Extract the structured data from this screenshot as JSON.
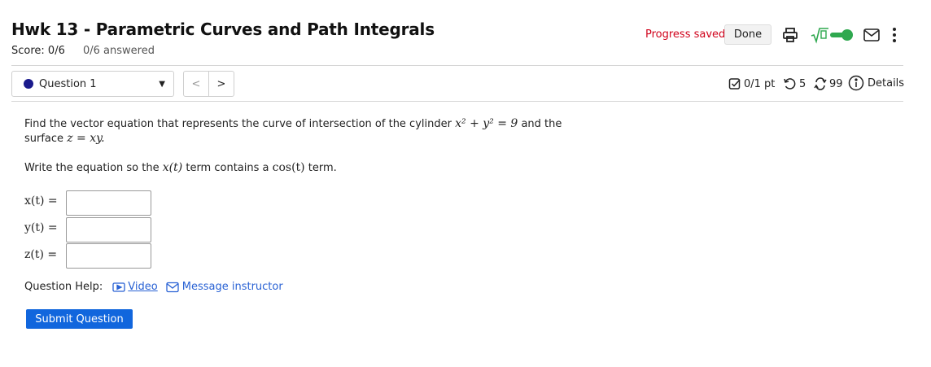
{
  "header": {
    "title": "Hwk 13 - Parametric Curves and Path Integrals",
    "score": "Score: 0/6",
    "answered": "0/6 answered",
    "progress_status": "Progress saved",
    "done_label": "Done",
    "icons": [
      "printer-icon",
      "sqrt-math-toggle-icon",
      "mail-icon",
      "more-vertical-icon"
    ]
  },
  "question_nav": {
    "selected": "Question 1",
    "prev_label": "<",
    "next_label": ">"
  },
  "stats": {
    "points": "0/1 pt",
    "attempts": "5",
    "versions": "99",
    "details_label": "Details"
  },
  "question": {
    "line1_prefix": "Find the vector equation that represents the curve of intersection of the cylinder",
    "cylinder_eq": "x² + y² = 9",
    "line1_suffix": "and the",
    "line2_prefix": "surface",
    "surface_eq": "z = xy.",
    "instruction_prefix": "Write the equation so the",
    "instruction_term": "x(t)",
    "instruction_mid": "term contains a",
    "instruction_func": "cos(t)",
    "instruction_suffix": "term."
  },
  "answers": [
    {
      "label": "x(t) =",
      "value": ""
    },
    {
      "label": "y(t) =",
      "value": ""
    },
    {
      "label": "z(t) =",
      "value": ""
    }
  ],
  "help": {
    "label": "Question Help:",
    "video_label": "Video",
    "message_label": "Message instructor"
  },
  "submit_label": "Submit Question",
  "colors": {
    "accent": "#1166dd",
    "status": "#d0021b",
    "link": "#2962d4",
    "toggle": "#2fa84f"
  }
}
